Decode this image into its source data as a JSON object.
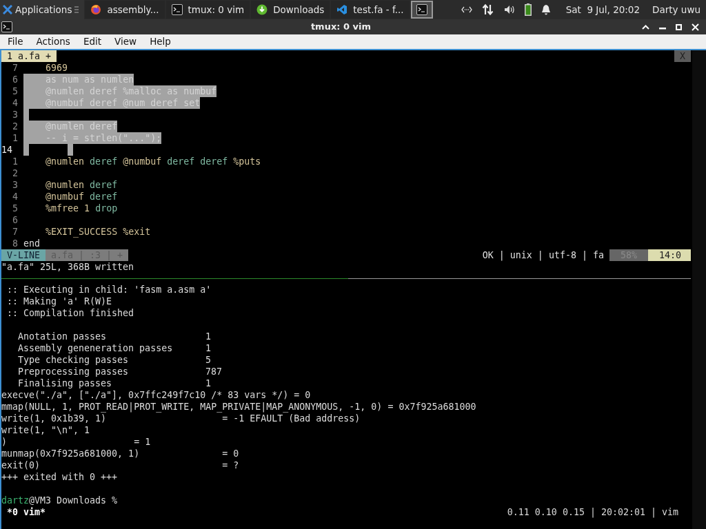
{
  "taskbar": {
    "apps_label": "Applications",
    "tasks": [
      {
        "kind": "browser",
        "label": "assembly...",
        "selected": false
      },
      {
        "kind": "terminal",
        "label": "tmux: 0 vim",
        "selected": false
      },
      {
        "kind": "download",
        "label": "Downloads",
        "selected": false
      },
      {
        "kind": "editor",
        "label": "test.fa - f...",
        "selected": false
      },
      {
        "kind": "terminal",
        "selected": true
      }
    ],
    "clock": "Sat  9 Jul, 20:02",
    "user": "Darty uwu"
  },
  "window": {
    "title": "tmux: 0 vim"
  },
  "menu": [
    "File",
    "Actions",
    "Edit",
    "View",
    "Help"
  ],
  "vim": {
    "tab": {
      "label": "1 a.fa +"
    },
    "close_label": "X",
    "lines": [
      {
        "number": "7",
        "current": false,
        "selected": false,
        "tokens": [
          {
            "text": "    6969",
            "kind": "ident"
          }
        ]
      },
      {
        "number": "6",
        "current": false,
        "selected": true,
        "text": "    as num as numlen"
      },
      {
        "number": "5",
        "current": false,
        "selected": true,
        "text": "    @numlen deref %malloc as numbuf"
      },
      {
        "number": "4",
        "current": false,
        "selected": true,
        "text": "    @numbuf deref @num deref set"
      },
      {
        "number": "3",
        "current": false,
        "selected": true
      },
      {
        "number": "2",
        "current": false,
        "selected": true,
        "text": "    @numlen deref"
      },
      {
        "number": "1",
        "current": false,
        "selected": true,
        "text": "    -- i = strlen(\"...\");"
      },
      {
        "number": "14",
        "current": true,
        "selected": true
      },
      {
        "number": "1",
        "current": false,
        "selected": false,
        "tokens": [
          {
            "text": "    @numlen",
            "kind": "ident"
          },
          {
            "text": " deref",
            "kind": "word"
          },
          {
            "text": " @numbuf",
            "kind": "ident"
          },
          {
            "text": " deref deref",
            "kind": "word"
          },
          {
            "text": " %puts",
            "kind": "ident"
          }
        ]
      },
      {
        "number": "2",
        "current": false,
        "selected": false
      },
      {
        "number": "3",
        "current": false,
        "selected": false,
        "tokens": [
          {
            "text": "    @numlen",
            "kind": "ident"
          },
          {
            "text": " deref",
            "kind": "word"
          }
        ]
      },
      {
        "number": "4",
        "current": false,
        "selected": false,
        "tokens": [
          {
            "text": "    @numbuf",
            "kind": "ident"
          },
          {
            "text": " deref",
            "kind": "word"
          }
        ]
      },
      {
        "number": "5",
        "current": false,
        "selected": false,
        "tokens": [
          {
            "text": "    %mfree 1",
            "kind": "ident"
          },
          {
            "text": " drop",
            "kind": "word"
          }
        ]
      },
      {
        "number": "6",
        "current": false,
        "selected": false
      },
      {
        "number": "7",
        "current": false,
        "selected": false,
        "tokens": [
          {
            "text": "    %EXIT_SUCCESS %exit",
            "kind": "ident"
          }
        ]
      },
      {
        "number": "8",
        "current": false,
        "selected": false,
        "tokens": [
          {
            "text": "end",
            "kind": "plain"
          }
        ]
      }
    ],
    "status": {
      "mode": "V-LINE",
      "file": "a.fa | :3 | +",
      "info": "OK | unix | utf-8 | fa",
      "percent": "58%",
      "position": "14:0"
    },
    "message": "\"a.fa\" 25L, 368B written"
  },
  "shell": {
    "log": [
      " :: Executing in child: 'fasm a.asm a'",
      " :: Making 'a' R(W)E",
      " :: Compilation finished"
    ],
    "stats": [
      {
        "label": "Anotation passes",
        "value": "1"
      },
      {
        "label": "Assembly geneneration passes",
        "value": "1"
      },
      {
        "label": "Type checking passes",
        "value": "5"
      },
      {
        "label": "Preprocessing passes",
        "value": "787"
      },
      {
        "label": "Finalising passes",
        "value": "1"
      }
    ],
    "trace": [
      "execve(\"./a\", [\"./a\"], 0x7ffc249f7c10 /* 83 vars */) = 0",
      "mmap(NULL, 1, PROT_READ|PROT_WRITE, MAP_PRIVATE|MAP_ANONYMOUS, -1, 0) = 0x7f925a681000",
      "write(1, 0x1b39, 1)                     = -1 EFAULT (Bad address)",
      "write(1, \"\\n\", 1",
      ")                       = 1",
      "munmap(0x7f925a681000, 1)               = 0",
      "exit(0)                                 = ?",
      "+++ exited with 0 +++"
    ],
    "prompt": {
      "user": "dartz",
      "rest": "@VM3 Downloads %"
    }
  },
  "tmux": {
    "window": " *0 vim*",
    "right": "0.11 0.10 0.15 | 20:02:01 | vim"
  }
}
